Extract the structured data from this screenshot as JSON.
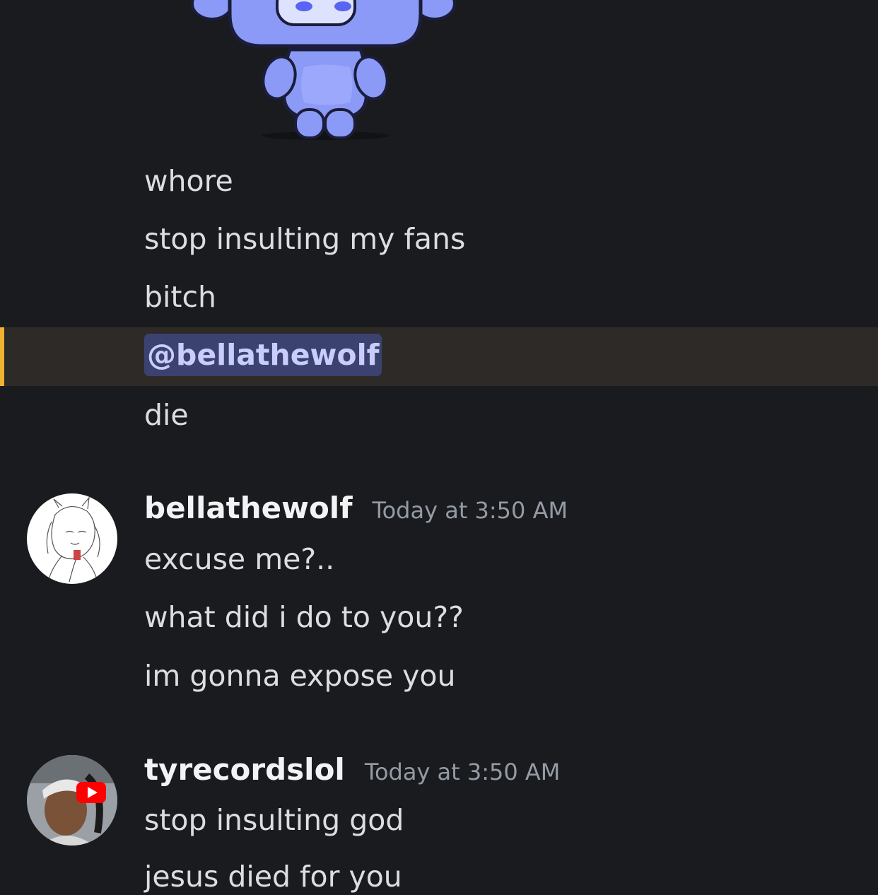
{
  "messages_top": [
    {
      "text": "whore"
    },
    {
      "text": "stop insulting my fans"
    },
    {
      "text": "bitch"
    },
    {
      "text": "die"
    }
  ],
  "mention": {
    "text": "@bellathewolf"
  },
  "groups": [
    {
      "username": "bellathewolf",
      "timestamp": "Today at 3:50 AM",
      "avatar": "sketch-avatar",
      "lines": [
        "excuse me?..",
        "what did i do to you??",
        "im gonna expose you"
      ]
    },
    {
      "username": "tyrecordslol",
      "timestamp": "Today at 3:50 AM",
      "avatar": "photo-avatar",
      "lines": [
        "stop insulting god",
        "jesus died for you"
      ]
    }
  ],
  "colors": {
    "background": "#1a1b1e",
    "highlight": "#2e2a27",
    "highlight_bar": "#f0b232",
    "mention_bg": "#3c4270",
    "mention_text": "#c9cdfb",
    "sticker_blue": "#7b8cf0"
  }
}
